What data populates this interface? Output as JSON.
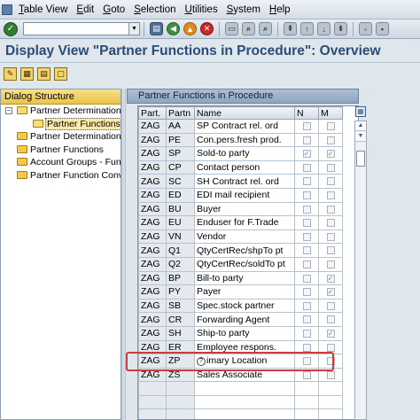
{
  "menu": [
    "Table View",
    "Edit",
    "Goto",
    "Selection",
    "Utilities",
    "System",
    "Help"
  ],
  "toolbar": {
    "command_value": ""
  },
  "title": "Display View \"Partner Functions in Procedure\": Overview",
  "dialog": {
    "header": "Dialog Structure",
    "items": [
      {
        "label": "Partner Determination l",
        "level": 0,
        "toggle": "-"
      },
      {
        "label": "Partner Functions in",
        "level": 1,
        "toggle": ""
      },
      {
        "label": "Partner Determination I",
        "level": 0,
        "toggle": ""
      },
      {
        "label": "Partner Functions",
        "level": 0,
        "toggle": ""
      },
      {
        "label": "Account Groups - Funct",
        "level": 0,
        "toggle": ""
      },
      {
        "label": "Partner Function Conve",
        "level": 0,
        "toggle": ""
      }
    ]
  },
  "table": {
    "title": "Partner Functions in Procedure",
    "columns": [
      "Part.",
      "Partn",
      "Name",
      "N",
      "M"
    ],
    "rows": [
      {
        "proc": "ZAG",
        "func": "AA",
        "name": "SP Contract rel. ord",
        "n": false,
        "m": false
      },
      {
        "proc": "ZAG",
        "func": "PE",
        "name": "Con.pers.fresh prod.",
        "n": false,
        "m": false
      },
      {
        "proc": "ZAG",
        "func": "SP",
        "name": "Sold-to party",
        "n": true,
        "m": true
      },
      {
        "proc": "ZAG",
        "func": "CP",
        "name": "Contact person",
        "n": false,
        "m": false
      },
      {
        "proc": "ZAG",
        "func": "SC",
        "name": "SH Contract rel. ord",
        "n": false,
        "m": false
      },
      {
        "proc": "ZAG",
        "func": "ED",
        "name": "EDI mail recipient",
        "n": false,
        "m": false
      },
      {
        "proc": "ZAG",
        "func": "BU",
        "name": "Buyer",
        "n": false,
        "m": false
      },
      {
        "proc": "ZAG",
        "func": "EU",
        "name": "Enduser for F.Trade",
        "n": false,
        "m": false
      },
      {
        "proc": "ZAG",
        "func": "VN",
        "name": "Vendor",
        "n": false,
        "m": false
      },
      {
        "proc": "ZAG",
        "func": "Q1",
        "name": "QtyCertRec/shpTo pt",
        "n": false,
        "m": false
      },
      {
        "proc": "ZAG",
        "func": "Q2",
        "name": "QtyCertRec/soldTo pt",
        "n": false,
        "m": false
      },
      {
        "proc": "ZAG",
        "func": "BP",
        "name": "Bill-to party",
        "n": false,
        "m": true
      },
      {
        "proc": "ZAG",
        "func": "PY",
        "name": "Payer",
        "n": false,
        "m": true
      },
      {
        "proc": "ZAG",
        "func": "SB",
        "name": "Spec.stock partner",
        "n": false,
        "m": false
      },
      {
        "proc": "ZAG",
        "func": "CR",
        "name": "Forwarding Agent",
        "n": false,
        "m": false
      },
      {
        "proc": "ZAG",
        "func": "SH",
        "name": "Ship-to party",
        "n": false,
        "m": true
      },
      {
        "proc": "ZAG",
        "func": "ER",
        "name": "Employee respons.",
        "n": false,
        "m": false
      },
      {
        "proc": "ZAG",
        "func": "ZP",
        "name": "imary Location",
        "n": false,
        "m": false
      },
      {
        "proc": "ZAG",
        "func": "ZS",
        "name": "Sales Associate",
        "n": false,
        "m": false
      }
    ],
    "empty_rows": 3
  },
  "colors": {
    "title": "#2b4b78",
    "highlight": "#cf3a3a",
    "dialog_header": "#e9c64a"
  }
}
